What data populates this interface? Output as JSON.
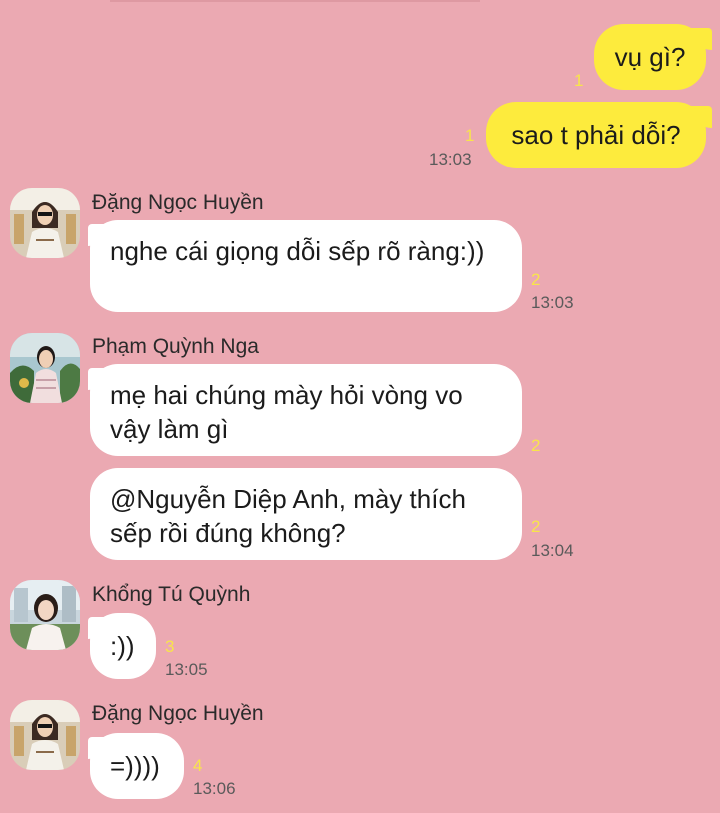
{
  "messages": [
    {
      "type": "out",
      "text": "vụ gì?",
      "count": "1"
    },
    {
      "type": "out",
      "text": "sao t phải dỗi?",
      "count": "1",
      "time": "13:03"
    },
    {
      "type": "in",
      "sender": "Đặng Ngọc Huyền",
      "text": "nghe cái giọng dỗi sếp rõ ràng:))",
      "count": "2",
      "time": "13:03"
    },
    {
      "type": "in",
      "sender": "Phạm Quỳnh Nga",
      "text": "mẹ hai chúng mày hỏi vòng vo vậy làm gì",
      "count": "2"
    },
    {
      "type": "in",
      "text": "@Nguyễn Diệp Anh, mày thích sếp rồi đúng không?",
      "count": "2",
      "time": "13:04"
    },
    {
      "type": "in",
      "sender": "Khổng Tú Quỳnh",
      "text": ":))",
      "count": "3",
      "time": "13:05"
    },
    {
      "type": "in",
      "sender": "Đặng Ngọc Huyền",
      "text": "=))))",
      "count": "4",
      "time": "13:06"
    }
  ],
  "colors": {
    "background": "#eba9b2",
    "outgoing_bubble": "#fdeb3d",
    "incoming_bubble": "#ffffff",
    "read_count": "#f8e54a"
  }
}
